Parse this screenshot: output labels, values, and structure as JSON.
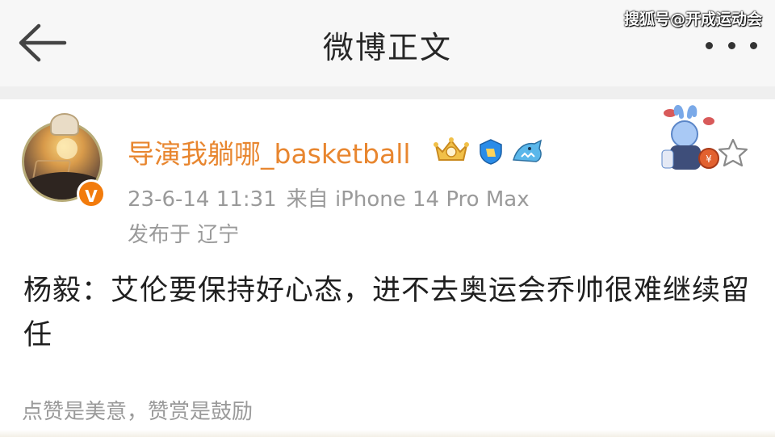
{
  "header": {
    "title": "微博正文",
    "back_icon": "arrow-left-icon",
    "more_icon": "more-dots-icon"
  },
  "watermark": "搜狐号@开成运动会",
  "author": {
    "name": "导演我躺哪_basketball",
    "verified_badge": "V",
    "badges": [
      "crown-badge-icon",
      "verified-shield-icon",
      "shark-badge-icon"
    ],
    "name_color": "#e8862f"
  },
  "post_meta": {
    "timestamp": "23-6-14 11:31",
    "source_prefix": "来自",
    "device": "iPhone 14 Pro Max",
    "location": "发布于 辽宁"
  },
  "post": {
    "text": "杨毅：艾伦要保持好心态，进不去奥运会乔帅很难继续留任"
  },
  "reward_note": "点赞是美意，赞赏是鼓励",
  "colors": {
    "accent": "#f27b0c",
    "meta_gray": "#9a9a9a",
    "body_text": "#1f1f1f"
  }
}
